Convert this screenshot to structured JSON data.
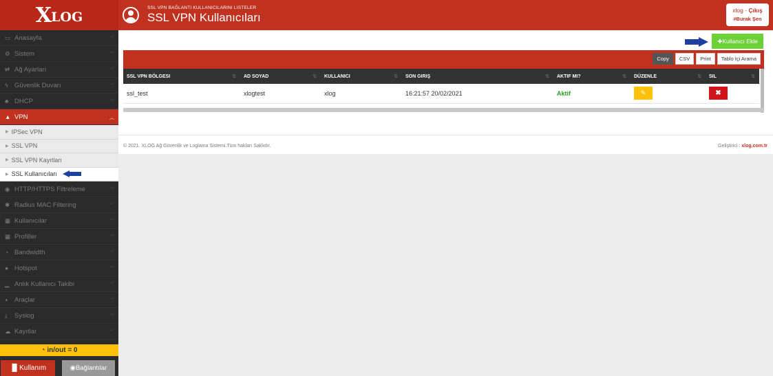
{
  "brand": {
    "logo_x": "X",
    "logo_rest": "LOG"
  },
  "header": {
    "subtitle": "SSL VPN BAĞLANTI KULLANICILARINI LISTELER",
    "title": "SSL VPN Kullanıcıları",
    "user": "xlog",
    "separator": " - ",
    "logout": "Çıkış",
    "user_tag": "#Burak Şen"
  },
  "sidebar": {
    "items": [
      {
        "icon": "▭",
        "label": "Anasayfa"
      },
      {
        "icon": "⚙",
        "label": "Sistem"
      },
      {
        "icon": "⇄",
        "label": "Ağ Ayarları"
      },
      {
        "icon": "ϟ",
        "label": "Güvenlik Duvarı"
      },
      {
        "icon": "♣",
        "label": "DHCP"
      },
      {
        "icon": "▲",
        "label": "VPN"
      }
    ],
    "vpn_sub": [
      "IPSec VPN",
      "SSL VPN",
      "SSL VPN Kayıtları",
      "SSL Kullanıcıları"
    ],
    "items_after": [
      {
        "icon": "◉",
        "label": "HTTP/HTTPS Filtreleme"
      },
      {
        "icon": "✱",
        "label": "Radius MAC Filtering"
      },
      {
        "icon": "▦",
        "label": "Kullanıcılar"
      },
      {
        "icon": "▦",
        "label": "Profiller"
      },
      {
        "icon": "◔",
        "label": "Bandwidth"
      },
      {
        "icon": "●",
        "label": "Hotspot"
      },
      {
        "icon": "▁",
        "label": "Anlık Kullanıcı Takibi"
      },
      {
        "icon": "◗",
        "label": "Araçlar"
      },
      {
        "icon": "⤓",
        "label": "Syslog"
      },
      {
        "icon": "☁",
        "label": "Kayıtlar"
      }
    ],
    "inout": "in/out = 0",
    "btn_kullanim": "Kullanım",
    "btn_baglantilar": "Bağlantılar"
  },
  "toolbar": {
    "add_user": "Kullanıcı Ekle"
  },
  "table_tools": [
    "Copy",
    "CSV",
    "Print",
    "Tablo İçi Arama"
  ],
  "table": {
    "headers": [
      "SSL VPN BÖLGESI",
      "AD SOYAD",
      "KULLANICI",
      "SON GIRIŞ",
      "AKTIF MI?",
      "DÜZENLE",
      "SIL"
    ],
    "rows": [
      {
        "bolge": "ssl_test",
        "ad_soyad": "xlogtest",
        "kullanici": "xlog",
        "son_giris": "16:21:57 20/02/2021",
        "aktif": "Aktif"
      }
    ]
  },
  "footer": {
    "copyright": "© 2021. XLOG Ağ Güvenlik ve Loglama Sistemi.Tüm hakları Saklıdır.",
    "dev_label": "Geliştirici : ",
    "dev_link": "xlog.com.tr"
  },
  "colors": {
    "brand_red": "#c0321f",
    "add_green": "#6cd037",
    "warning": "#ffc10a",
    "danger": "#d0151b",
    "arrow_blue": "#1f3fa0"
  }
}
